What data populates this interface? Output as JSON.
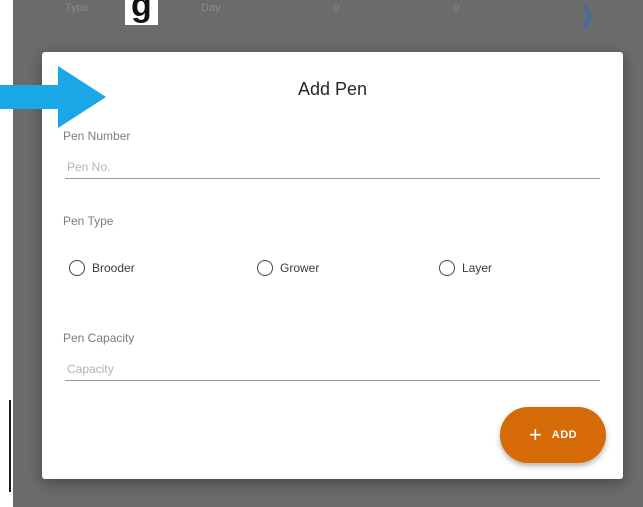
{
  "background": {
    "heading_fragment": "g",
    "row": [
      "Type",
      "Day",
      "0",
      "0"
    ],
    "chevron_icon": "chevron-right-icon"
  },
  "modal": {
    "title": "Add Pen",
    "pen_number": {
      "label": "Pen Number",
      "placeholder": "Pen No.",
      "value": ""
    },
    "pen_type": {
      "label": "Pen Type",
      "options": [
        "Brooder",
        "Grower",
        "Layer"
      ],
      "selected": null
    },
    "pen_capacity": {
      "label": "Pen Capacity",
      "placeholder": "Capacity",
      "value": ""
    },
    "add_button": {
      "icon": "plus-icon",
      "label": "ADD"
    }
  },
  "annotation": {
    "arrow_icon": "arrow-right-icon",
    "arrow_color": "#1aa7e8"
  },
  "colors": {
    "accent": "#d66a07",
    "backdrop": "#6b6b6b"
  }
}
